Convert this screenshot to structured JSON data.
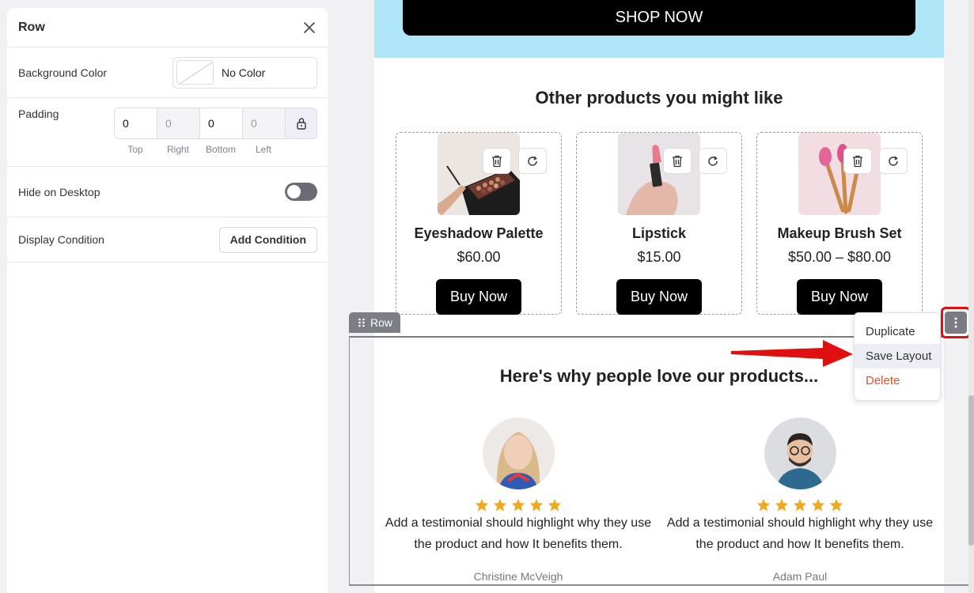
{
  "panel": {
    "title": "Row",
    "background_color_label": "Background Color",
    "background_color_value": "No Color",
    "padding_label": "Padding",
    "padding": [
      {
        "value": "0",
        "label": "Top"
      },
      {
        "value": "0",
        "label": "Right"
      },
      {
        "value": "0",
        "label": "Bottom"
      },
      {
        "value": "0",
        "label": "Left"
      }
    ],
    "hide_on_desktop_label": "Hide on Desktop",
    "hide_on_desktop_on": false,
    "display_condition_label": "Display Condition",
    "add_condition_label": "Add Condition"
  },
  "email": {
    "hero_bg": "#aee6f7",
    "shop_now_label": "SHOP NOW",
    "products_title": "Other products you might like",
    "products": [
      {
        "name": "Eyeshadow Palette",
        "price": "$60.00",
        "button": "Buy Now"
      },
      {
        "name": "Lipstick",
        "price": "$15.00",
        "button": "Buy Now"
      },
      {
        "name": "Makeup Brush Set",
        "price": "$50.00 – $80.00",
        "button": "Buy Now"
      }
    ],
    "row_tag_label": "Row",
    "testimonials_title": "Here's why people love our products...",
    "testimonials": [
      {
        "text": "Add a testimonial should highlight why they use the product and how It benefits them.",
        "name": "Christine McVeigh",
        "rating": 5
      },
      {
        "text": "Add a testimonial should highlight why they use the product and how It benefits them.",
        "name": "Adam Paul",
        "rating": 5
      }
    ]
  },
  "context_menu": {
    "items": [
      "Duplicate",
      "Save Layout",
      "Delete"
    ],
    "active": "Save Layout"
  },
  "colors": {
    "accent_red": "#e01010",
    "star": "#f0a820",
    "delete": "#d9542f"
  }
}
